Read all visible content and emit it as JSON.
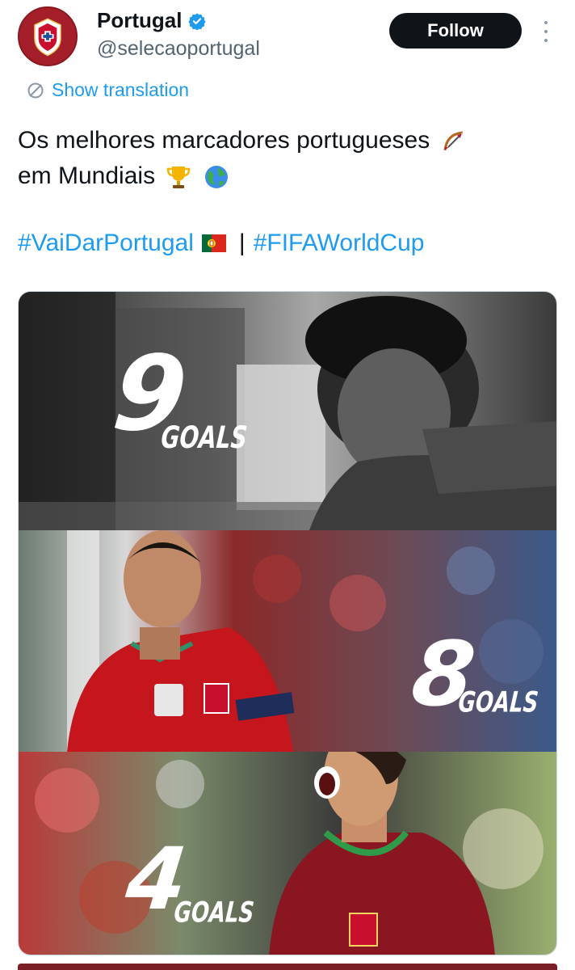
{
  "account": {
    "display_name": "Portugal",
    "handle": "@selecaoportugal",
    "verified_icon": "verified-badge-icon",
    "follow_label": "Follow",
    "brand_color": "#a51f2a"
  },
  "translation": {
    "label": "Show translation"
  },
  "tweet": {
    "line1": "Os melhores marcadores portugueses",
    "line1_emoji": "bow-and-arrow-emoji",
    "line2": "em Mundiais",
    "line2_emojis": [
      "trophy-emoji",
      "globe-emoji"
    ],
    "hashtag1": "#VaiDarPortugal",
    "hashtag1_emoji": "portugal-flag-emoji",
    "separator": "|",
    "hashtag2": "#FIFAWorldCup"
  },
  "media": {
    "panels": [
      {
        "number": "9",
        "word": "GOALS"
      },
      {
        "number": "8",
        "word": "GOALS"
      },
      {
        "number": "4",
        "word": "GOALS"
      }
    ]
  },
  "colors": {
    "link": "#1d9bf0",
    "text": "#0f1419",
    "muted": "#536471",
    "follow_bg": "#0f1419"
  }
}
